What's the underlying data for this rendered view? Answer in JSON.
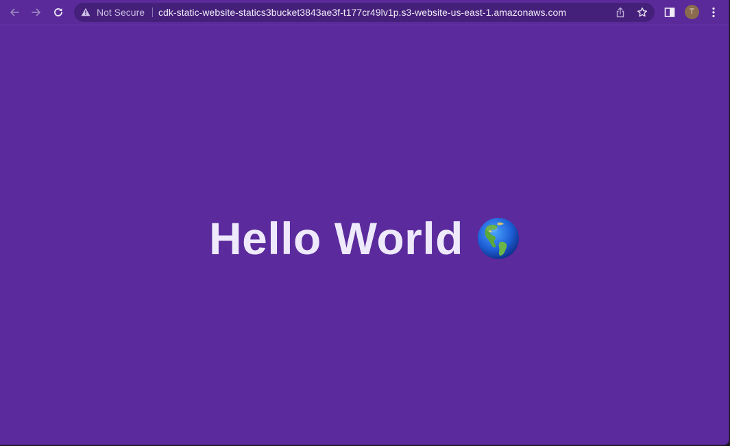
{
  "toolbar": {
    "back_icon": "arrow-left-icon",
    "forward_icon": "arrow-right-icon",
    "reload_icon": "reload-icon",
    "security_icon": "warning-triangle-icon",
    "security_label": "Not Secure",
    "url": "cdk-static-website-statics3bucket3843ae3f-t177cr49lv1p.s3-website-us-east-1.amazonaws.com",
    "share_icon": "share-icon",
    "bookmark_icon": "star-icon",
    "sidepanel_icon": "side-panel-icon",
    "profile_initial": "T",
    "menu_icon": "kebab-menu-icon"
  },
  "page": {
    "heading": "Hello World",
    "emoji_icon": "globe-americas-icon",
    "background_color": "#5b2a9c",
    "text_color": "#eeeafc"
  }
}
